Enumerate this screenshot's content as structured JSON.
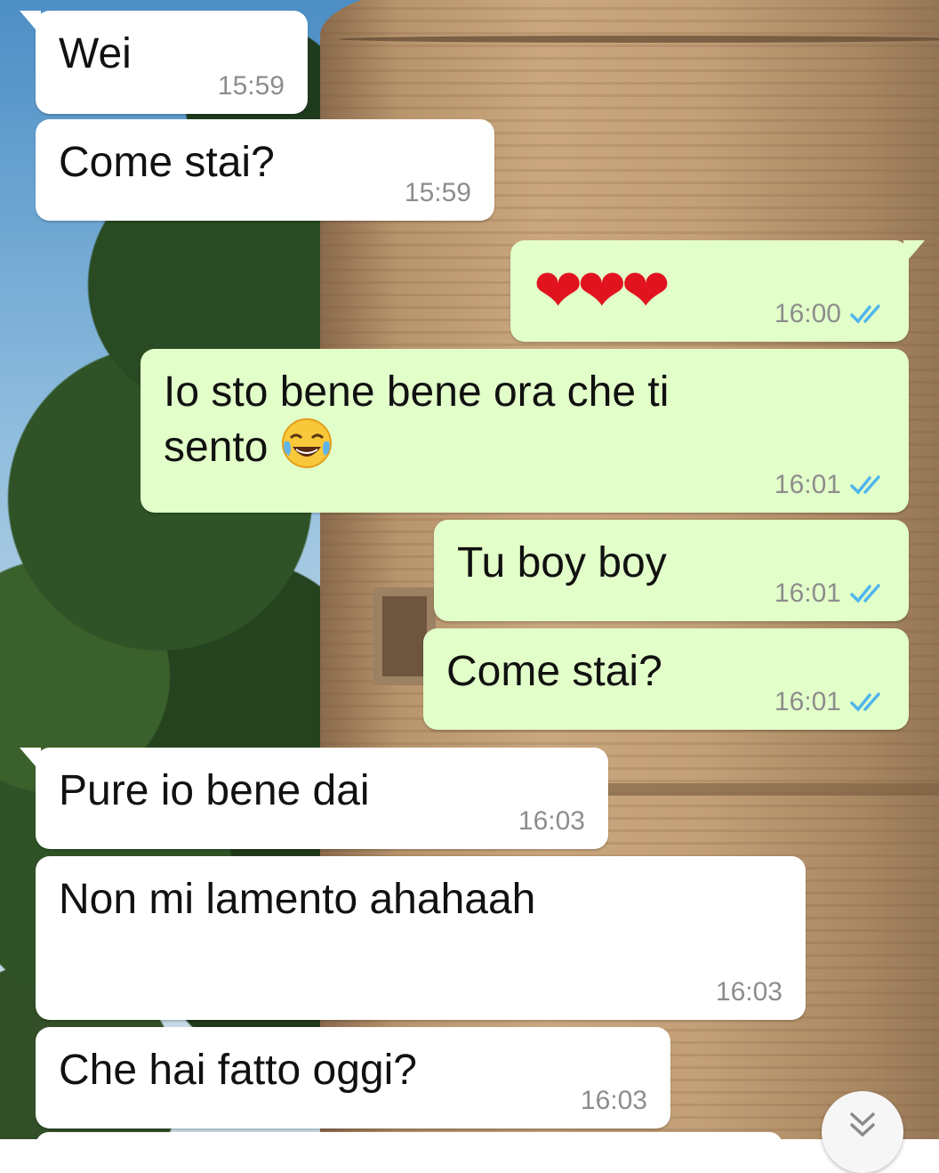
{
  "messages": [
    {
      "dir": "in",
      "text": "Wei",
      "time": "15:59"
    },
    {
      "dir": "in",
      "text": "Come stai?",
      "time": "15:59"
    },
    {
      "dir": "out",
      "text": "❤❤❤",
      "time": "16:00",
      "status": "read"
    },
    {
      "dir": "out",
      "text": "Io sto bene bene ora che ti\nsento",
      "emoji": "face-with-tears-of-joy",
      "time": "16:01",
      "status": "read"
    },
    {
      "dir": "out",
      "text": "Tu boy boy",
      "time": "16:01",
      "status": "read"
    },
    {
      "dir": "out",
      "text": "Come stai?",
      "time": "16:01",
      "status": "read"
    },
    {
      "dir": "in",
      "text": "Pure io bene dai",
      "time": "16:03"
    },
    {
      "dir": "in",
      "text": "Non mi lamento ahahaah",
      "time": "16:03"
    },
    {
      "dir": "in",
      "text": "Che hai fatto oggi?",
      "time": "16:03"
    }
  ],
  "icons": {
    "read_ticks": "double-check-icon",
    "scroll_down": "double-chevron-down-icon"
  },
  "colors": {
    "incoming": "#ffffff",
    "outgoing": "#e2ffc9",
    "read_tick": "#4fb6ec",
    "time": "#8d8d8d"
  }
}
